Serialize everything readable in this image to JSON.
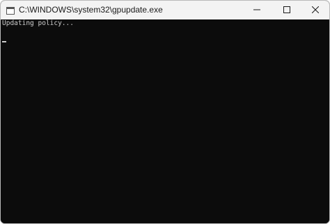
{
  "window": {
    "title": "C:\\WINDOWS\\system32\\gpupdate.exe",
    "caption_buttons": {
      "minimize_icon": "minimize-icon",
      "maximize_icon": "maximize-icon",
      "close_icon": "close-icon"
    }
  },
  "console": {
    "lines": [
      "Updating policy..."
    ],
    "background": "#0c0c0c",
    "text_color": "#cccccc"
  },
  "colors": {
    "titlebar": "#f3f3f3",
    "title_text": "#1a1a1a"
  }
}
